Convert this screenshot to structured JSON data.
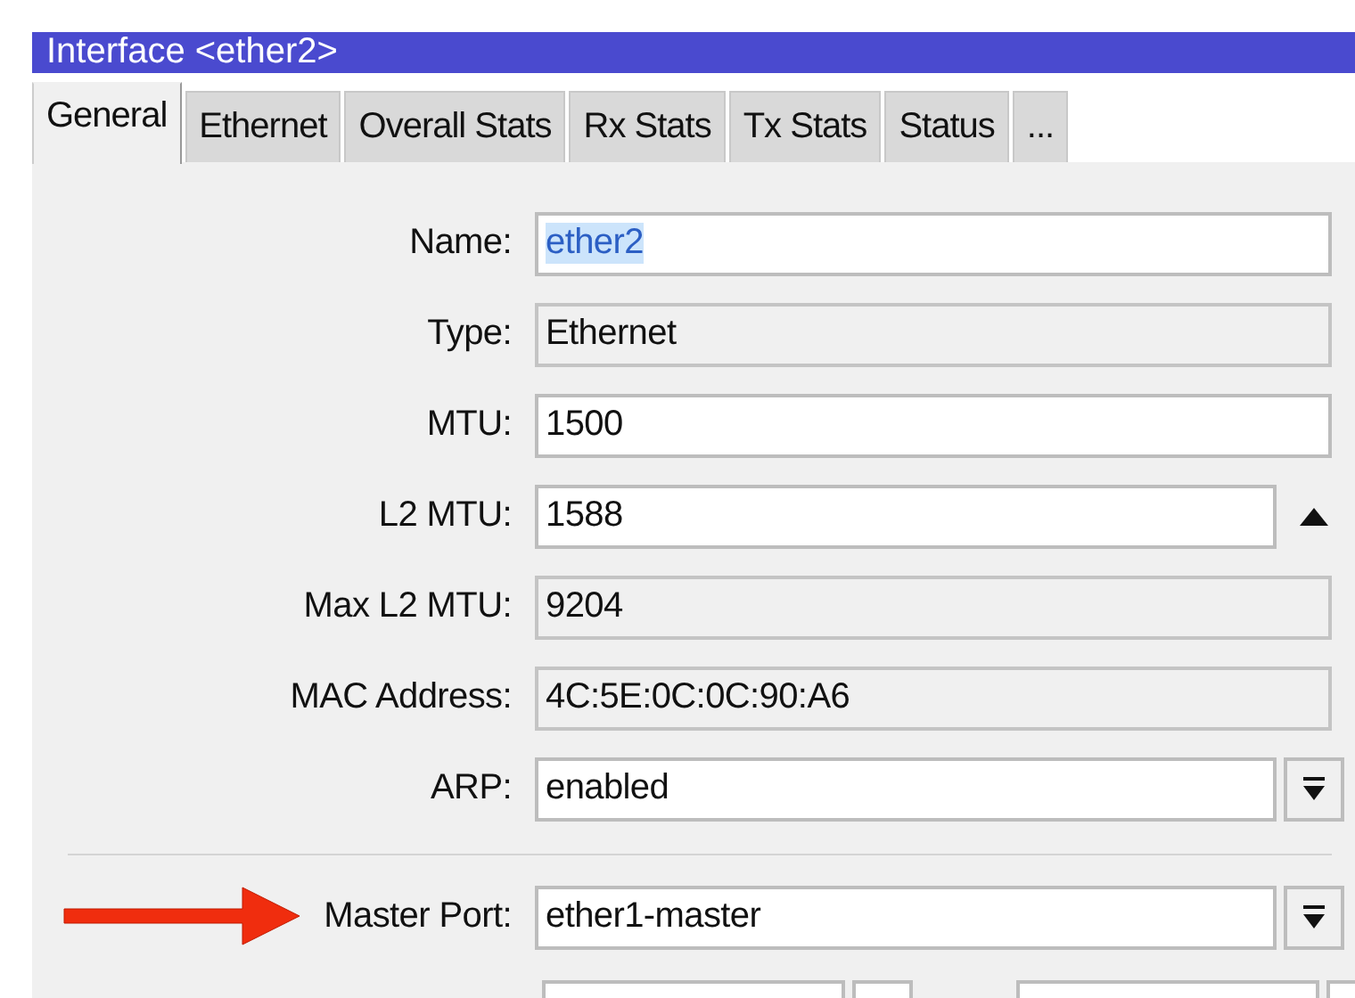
{
  "window": {
    "title": "Interface <ether2>"
  },
  "tabs": [
    {
      "label": "General",
      "selected": true
    },
    {
      "label": "Ethernet",
      "selected": false
    },
    {
      "label": "Overall Stats",
      "selected": false
    },
    {
      "label": "Rx Stats",
      "selected": false
    },
    {
      "label": "Tx Stats",
      "selected": false
    },
    {
      "label": "Status",
      "selected": false
    },
    {
      "label": "...",
      "selected": false
    }
  ],
  "fields": [
    {
      "label": "Name:",
      "value": "ether2",
      "editable": true,
      "highlighted": true,
      "kind": "plain"
    },
    {
      "label": "Type:",
      "value": "Ethernet",
      "editable": false,
      "highlighted": false,
      "kind": "plain"
    },
    {
      "label": "MTU:",
      "value": "1500",
      "editable": true,
      "highlighted": false,
      "kind": "plain"
    },
    {
      "label": "L2 MTU:",
      "value": "1588",
      "editable": true,
      "highlighted": false,
      "kind": "collapse"
    },
    {
      "label": "Max L2 MTU:",
      "value": "9204",
      "editable": false,
      "highlighted": false,
      "kind": "plain"
    },
    {
      "label": "MAC Address:",
      "value": "4C:5E:0C:0C:90:A6",
      "editable": false,
      "highlighted": false,
      "kind": "plain"
    },
    {
      "label": "ARP:",
      "value": "enabled",
      "editable": true,
      "highlighted": false,
      "kind": "dropdown"
    },
    {
      "label": "Master Port:",
      "value": "ether1-master",
      "editable": true,
      "highlighted": false,
      "kind": "dropdown",
      "divider_before": true,
      "annotated": true
    }
  ]
}
